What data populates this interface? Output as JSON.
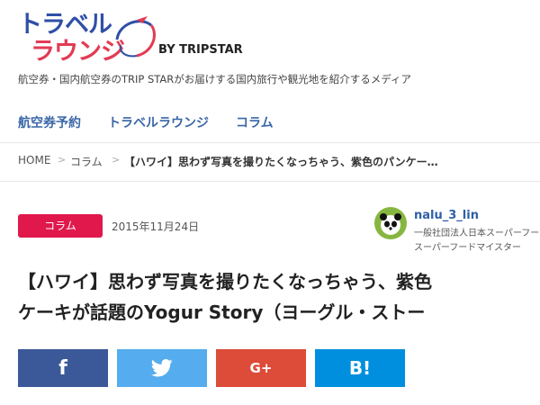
{
  "header": {
    "logo_line1": "トラベル",
    "logo_line2": "ラウンジ",
    "logo_by": "BY TRIPSTAR",
    "tagline": "航空券・国内航空券のTRIP STARがお届けする国内旅行や観光地を紹介するメディア"
  },
  "nav": {
    "items": [
      "航空券予約",
      "トラベルラウンジ",
      "コラム"
    ]
  },
  "breadcrumb": {
    "items": [
      "HOME",
      "コラム",
      "【ハワイ】思わず写真を撮りたくなっちゃう、紫色のパンケー…"
    ]
  },
  "article": {
    "category": "コラム",
    "date": "2015年11月24日",
    "title_line1": "【ハワイ】思わず写真を撮りたくなっちゃう、紫色",
    "title_line2": "ケーキが話題のYogur Story（ヨーグル・ストー"
  },
  "author": {
    "name": "nalu_3_lin",
    "desc_line1": "一般社団法人日本スーパーフー",
    "desc_line2": "スーパーフードマイスター"
  },
  "share": {
    "facebook": "f",
    "gplus": "G+",
    "hatena": "B!",
    "icons": [
      "facebook-icon",
      "twitter-icon",
      "google-plus-icon",
      "hatena-bookmark-icon"
    ]
  },
  "colors": {
    "logo_blue": "#2f4fa6",
    "logo_red": "#e23b54",
    "nav_blue": "#3a67a8",
    "badge_red": "#e0184c",
    "facebook": "#3b5998",
    "twitter": "#55acee",
    "gplus": "#dd4b39",
    "hatena": "#008fde"
  }
}
